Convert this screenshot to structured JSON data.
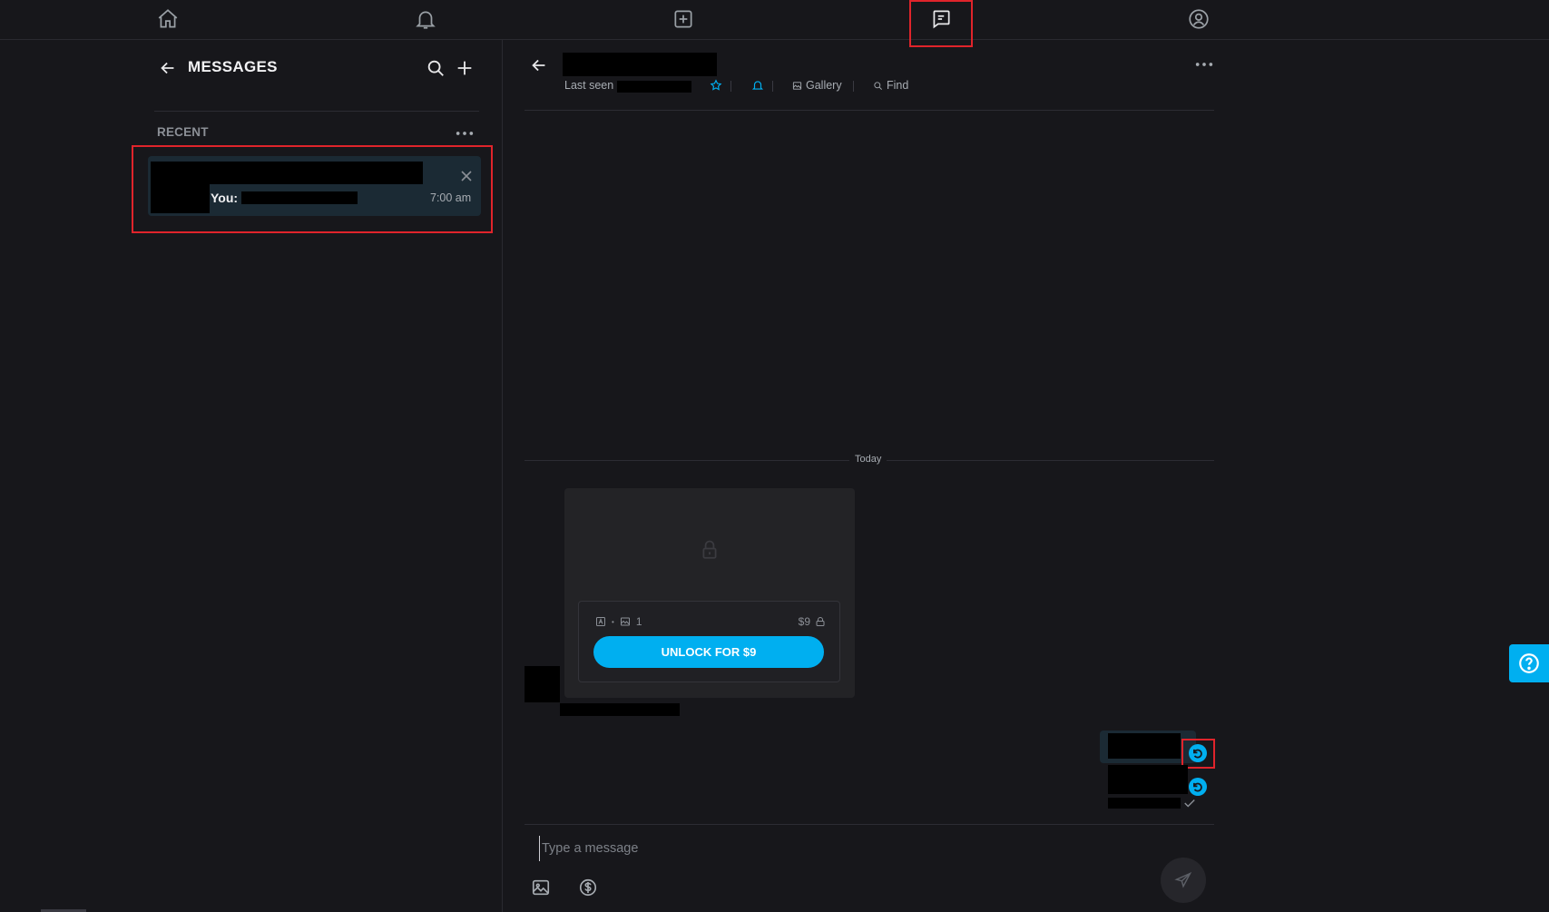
{
  "topnav": {
    "items": [
      "home-icon",
      "bell-icon",
      "plus-square-icon",
      "messages-icon",
      "profile-icon"
    ],
    "active": "messages-icon"
  },
  "sidebar": {
    "title": "MESSAGES",
    "section_label": "RECENT",
    "chat": {
      "preview_prefix": "You:",
      "time": "7:00 am"
    }
  },
  "conversation": {
    "status_prefix": "Last seen",
    "links": {
      "gallery": "Gallery",
      "find": "Find"
    },
    "divider_label": "Today",
    "locked_message": {
      "media_count": "1",
      "price": "$9",
      "unlock_label": "UNLOCK FOR $9"
    },
    "composer": {
      "placeholder": "Type a message"
    }
  },
  "colors": {
    "background": "#17171b",
    "accent": "#00aff0",
    "highlight": "#e0242b"
  }
}
